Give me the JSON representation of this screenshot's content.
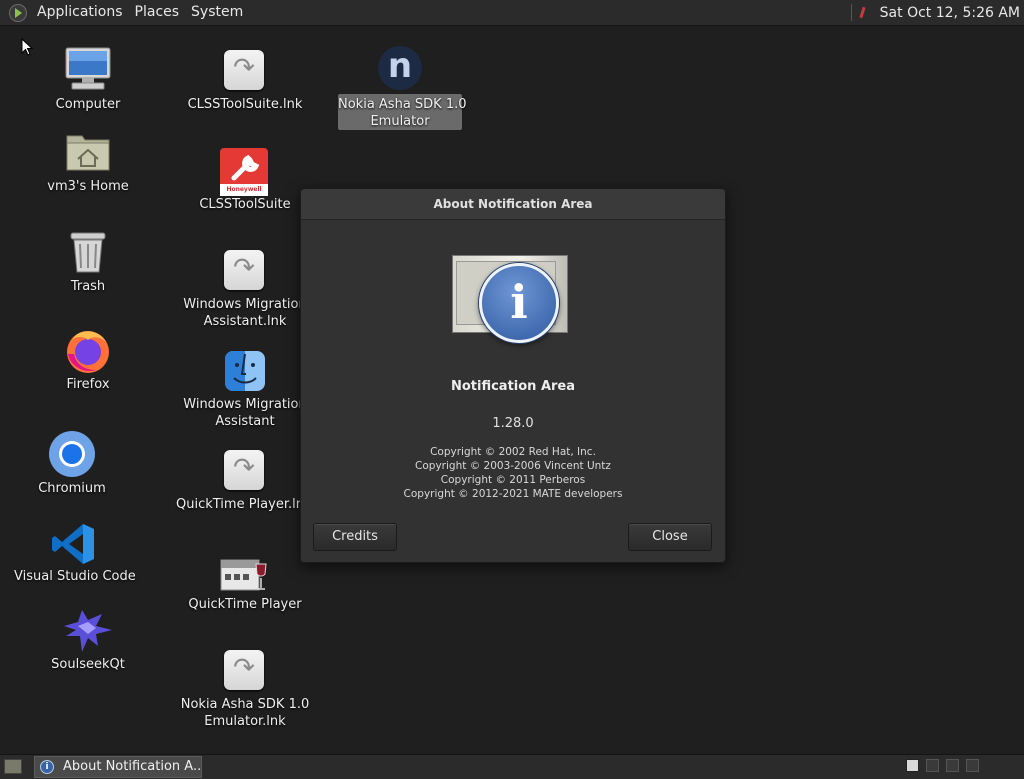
{
  "top_panel": {
    "menus": [
      "Applications",
      "Places",
      "System"
    ],
    "clock": "Sat Oct 12,  5:26 AM",
    "tray_icons": [
      "menu-logo-icon",
      "network-icon"
    ]
  },
  "desktop": {
    "icons": [
      {
        "label": "Computer",
        "icon": "computer-icon"
      },
      {
        "label": "vm3's Home",
        "icon": "home-folder-icon"
      },
      {
        "label": "Trash",
        "icon": "trash-icon"
      },
      {
        "label": "Firefox",
        "icon": "firefox-icon"
      },
      {
        "label": "Chromium",
        "icon": "chromium-icon"
      },
      {
        "label": "Visual Studio Code",
        "icon": "vscode-icon"
      },
      {
        "label": "SoulseekQt",
        "icon": "soulseek-icon"
      },
      {
        "label": "CLSSToolSuite.lnk",
        "icon": "shortcut-icon"
      },
      {
        "label": "CLSSToolSuite",
        "icon": "honeywell-wrench-icon",
        "badge": "Honeywell"
      },
      {
        "label": "Windows Migration",
        "label2": "Assistant.lnk",
        "icon": "shortcut-icon"
      },
      {
        "label": "Windows Migration",
        "label2": "Assistant",
        "icon": "finder-icon"
      },
      {
        "label": "QuickTime Player.lnk",
        "icon": "shortcut-icon"
      },
      {
        "label": "QuickTime Player",
        "icon": "wine-app-icon"
      },
      {
        "label": "Nokia Asha SDK 1.0",
        "label2": "Emulator.lnk",
        "icon": "shortcut-icon"
      },
      {
        "label": "Nokia Asha SDK 1.0",
        "label2": "Emulator",
        "icon": "nokia-n-icon",
        "glyph": "n"
      }
    ]
  },
  "dialog": {
    "title": "About Notification Area",
    "app_name": "Notification Area",
    "version": "1.28.0",
    "copyright": [
      "Copyright © 2002 Red Hat, Inc.",
      "Copyright © 2003-2006 Vincent Untz",
      "Copyright © 2011 Perberos",
      "Copyright © 2012-2021 MATE developers"
    ],
    "credits_label": "Credits",
    "close_label": "Close",
    "icon": "info-icon",
    "icon_glyph": "i"
  },
  "bottom_panel": {
    "task_label": "About Notification A...",
    "task_glyph": "i"
  },
  "colors": {
    "desktop_bg": "#1f1f1f",
    "panel_bg": "#2b2b2b",
    "dialog_bg": "#323232",
    "info_blue": "#3a64a8",
    "selection_bg": "#6a6a6a"
  }
}
